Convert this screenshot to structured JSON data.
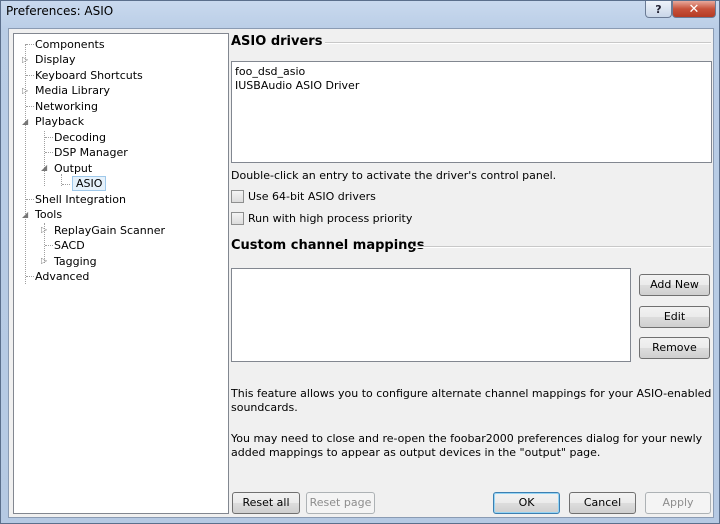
{
  "window": {
    "title": "Preferences: ASIO",
    "help_glyph": "?",
    "close_glyph": "✕"
  },
  "tree": {
    "items": [
      {
        "label": "Components"
      },
      {
        "label": "Display"
      },
      {
        "label": "Keyboard Shortcuts"
      },
      {
        "label": "Media Library"
      },
      {
        "label": "Networking"
      },
      {
        "label": "Playback"
      },
      {
        "label": "Decoding"
      },
      {
        "label": "DSP Manager"
      },
      {
        "label": "Output"
      },
      {
        "label": "ASIO"
      },
      {
        "label": "Shell Integration"
      },
      {
        "label": "Tools"
      },
      {
        "label": "ReplayGain Scanner"
      },
      {
        "label": "SACD"
      },
      {
        "label": "Tagging"
      },
      {
        "label": "Advanced"
      }
    ]
  },
  "asio": {
    "title": "ASIO drivers",
    "drivers": [
      "foo_dsd_asio",
      "IUSBAudio ASIO Driver"
    ],
    "hint": "Double-click an entry to activate the driver's control panel.",
    "opt_64bit": "Use 64-bit ASIO drivers",
    "opt_priority": "Run with high process priority"
  },
  "mappings": {
    "title": "Custom channel mappings",
    "add_new": "Add New",
    "edit": "Edit",
    "remove": "Remove",
    "desc1_line1": "This feature allows you to configure alternate channel mappings for your ASIO-enabled",
    "desc1_line2": "soundcards.",
    "desc2_line1": "You may need to close and re-open the foobar2000 preferences dialog for your newly",
    "desc2_line2": "added mappings to appear as output devices in the \"output\" page."
  },
  "footer": {
    "reset_all": "Reset all",
    "reset_page": "Reset page",
    "ok": "OK",
    "cancel": "Cancel",
    "apply": "Apply"
  }
}
